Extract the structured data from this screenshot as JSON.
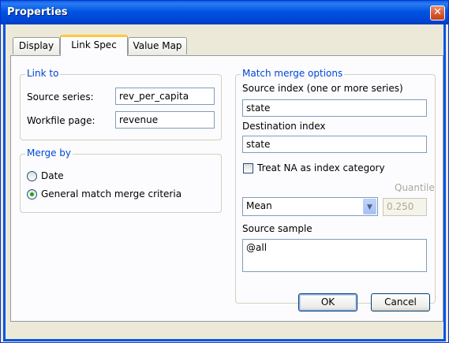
{
  "window": {
    "title": "Properties",
    "close_glyph": "✕"
  },
  "tabs": [
    {
      "label": "Display"
    },
    {
      "label": "Link Spec"
    },
    {
      "label": "Value Map"
    }
  ],
  "link_to": {
    "legend": "Link to",
    "source_series_label": "Source series:",
    "source_series_value": "rev_per_capita",
    "workfile_page_label": "Workfile page:",
    "workfile_page_value": "revenue"
  },
  "merge_by": {
    "legend": "Merge by",
    "options": [
      {
        "label": "Date",
        "selected": false
      },
      {
        "label": "General match merge criteria",
        "selected": true
      }
    ]
  },
  "match_merge": {
    "legend": "Match merge options",
    "source_index_label": "Source index (one or more series)",
    "source_index_value": "state",
    "destination_index_label": "Destination index",
    "destination_index_value": "state",
    "treat_na_label": "Treat NA as index category",
    "treat_na_checked": false,
    "method_value": "Mean",
    "quantile_label": "Quantile",
    "quantile_value": "0.250",
    "source_sample_label": "Source sample",
    "source_sample_value": "@all"
  },
  "buttons": {
    "ok": "OK",
    "cancel": "Cancel"
  },
  "colors": {
    "title_bar": "#0054e3",
    "group_legend": "#0046d5",
    "radio_dot": "#21a121"
  }
}
